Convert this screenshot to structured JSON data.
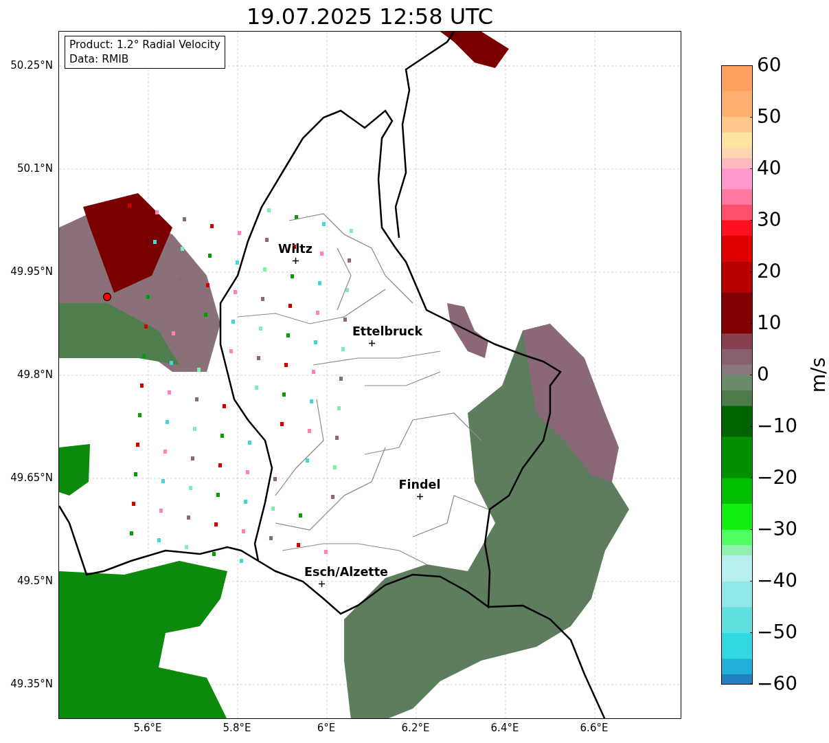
{
  "title": "19.07.2025 12:58 UTC",
  "info_box": {
    "product": "Product: 1.2° Radial Velocity",
    "data": "Data: RMIB"
  },
  "cities": [
    {
      "name": "Wiltz"
    },
    {
      "name": "Ettelbruck"
    },
    {
      "name": "Findel"
    },
    {
      "name": "Esch/Alzette"
    }
  ],
  "lat_ticks": [
    "50.25°N",
    "50.1°N",
    "49.95°N",
    "49.8°N",
    "49.65°N",
    "49.5°N",
    "49.35°N"
  ],
  "lon_ticks": [
    "5.6°E",
    "5.8°E",
    "6°E",
    "6.2°E",
    "6.4°E",
    "6.6°E"
  ],
  "colorbar": {
    "label": "m/s",
    "ticks": [
      "60",
      "50",
      "40",
      "30",
      "20",
      "10",
      "0",
      "−10",
      "−20",
      "−30",
      "−40",
      "−50",
      "−60"
    ]
  }
}
